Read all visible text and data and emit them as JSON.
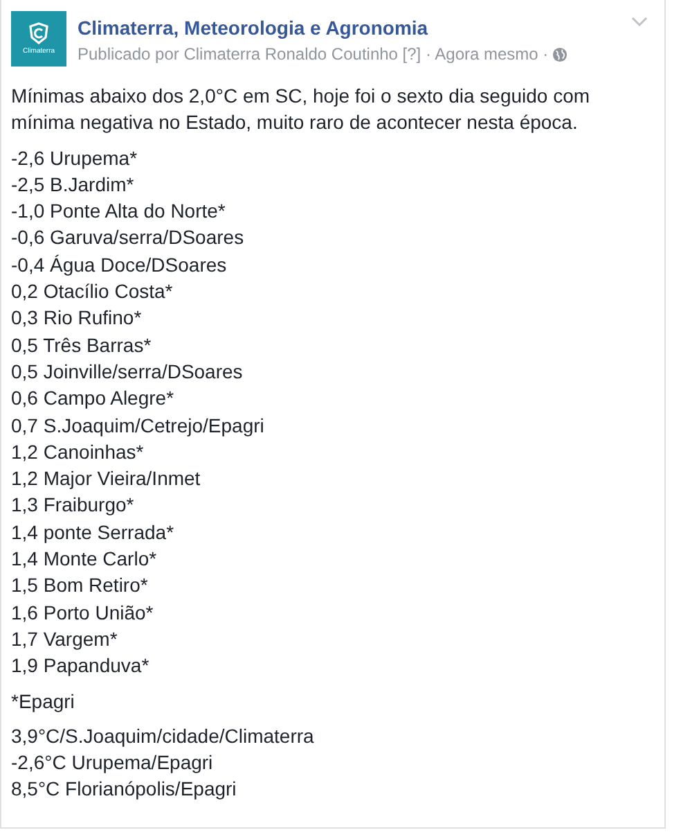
{
  "post": {
    "logo_text": "Climaterra",
    "page_name": "Climaterra, Meteorologia e Agronomia",
    "meta": "Publicado por Climaterra Ronaldo Coutinho [?] · Agora mesmo ·",
    "intro": "Mínimas abaixo dos 2,0°C em SC, hoje foi o sexto dia seguido com mínima negativa no Estado, muito raro de acontecer nesta época.",
    "paragraphs": [
      [
        "-2,6 Urupema*",
        "-2,5 B.Jardim*",
        "-1,0 Ponte Alta do Norte*",
        "-0,6 Garuva/serra/DSoares",
        "-0,4 Água Doce/DSoares",
        "0,2 Otacílio Costa*",
        "0,3 Rio Rufino*",
        "0,5 Três Barras*",
        "0,5 Joinville/serra/DSoares",
        "0,6 Campo Alegre*",
        "0,7 S.Joaquim/Cetrejo/Epagri",
        "1,2 Canoinhas*",
        "1,2 Major Vieira/Inmet",
        "1,3 Fraiburgo*",
        "1,4 ponte Serrada*",
        "1,4 Monte Carlo*",
        "1,5 Bom Retiro*",
        "1,6 Porto União*",
        "1,7 Vargem*",
        "1,9 Papanduva*"
      ],
      [
        "*Epagri"
      ],
      [
        "3,9°C/S.Joaquim/cidade/Climaterra",
        "-2,6°C Urupema/Epagri",
        "8,5°C Florianópolis/Epagri"
      ]
    ]
  }
}
